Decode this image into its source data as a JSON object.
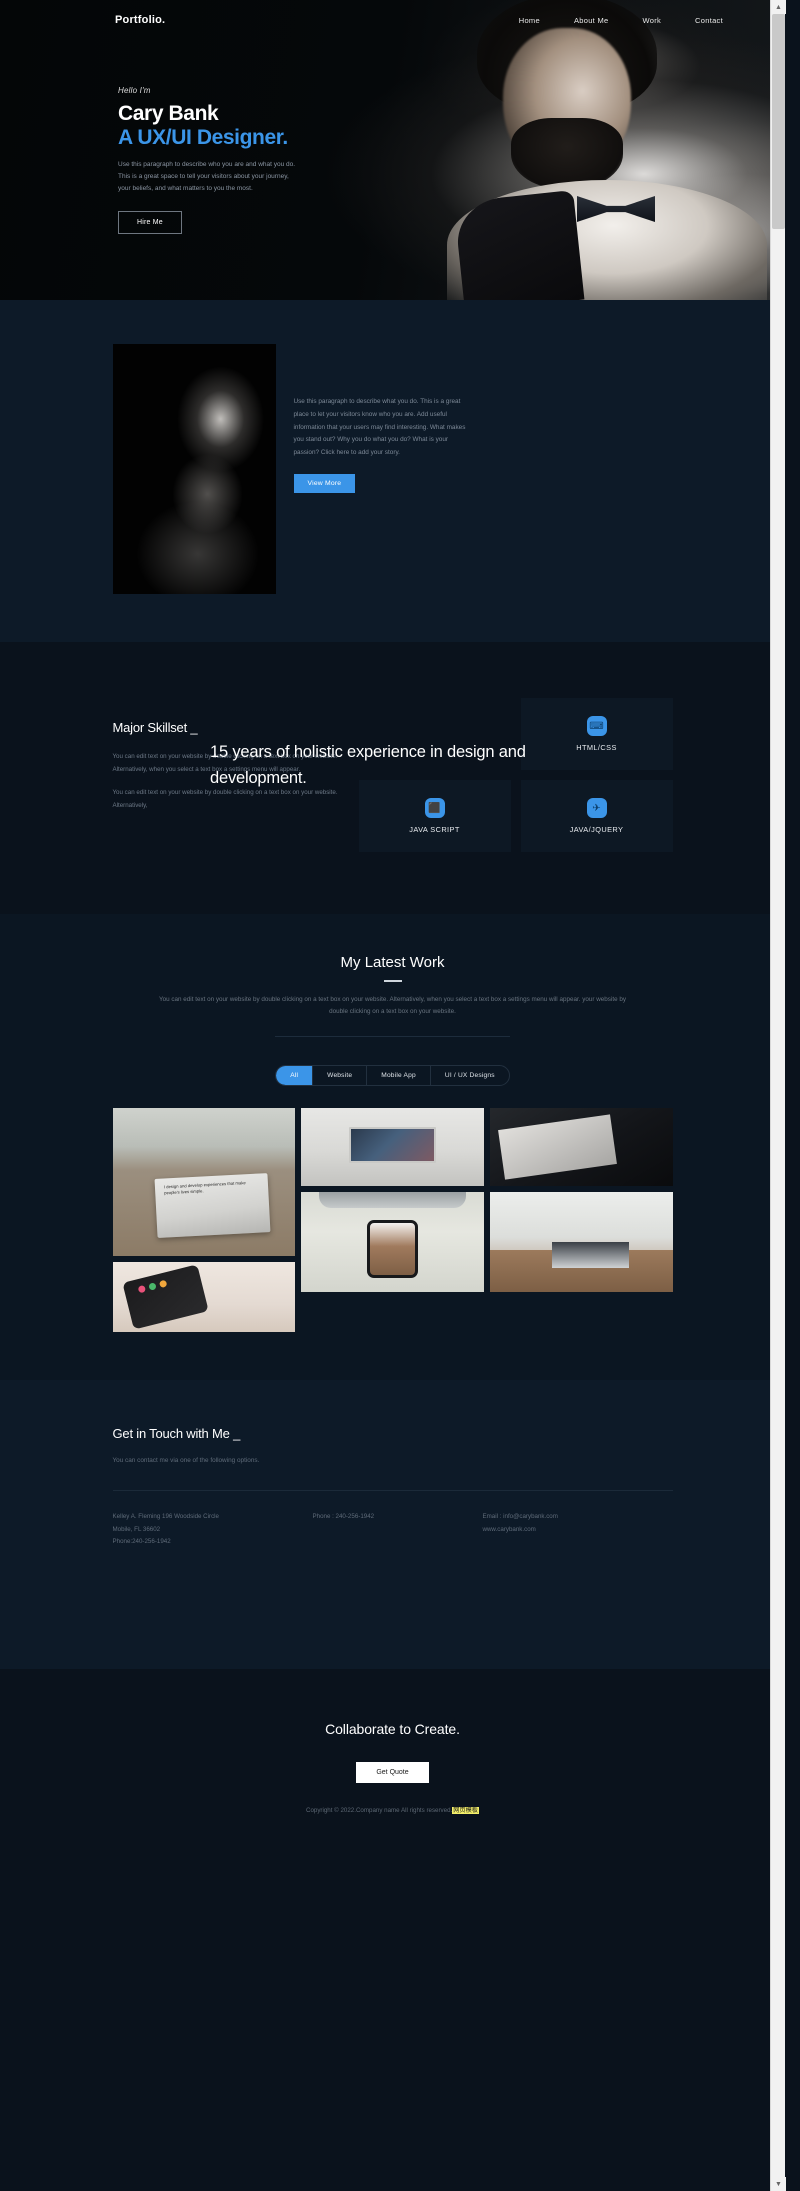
{
  "nav": {
    "logo": "Portfolio.",
    "links": [
      {
        "label": "Home"
      },
      {
        "label": "About Me"
      },
      {
        "label": "Work"
      },
      {
        "label": "Contact"
      }
    ]
  },
  "hero": {
    "greeting": "Hello I'm",
    "name": "Cary Bank",
    "role": "A UX/UI Designer.",
    "description": "Use this paragraph to describe who you are and what you do. This is a great space to tell your visitors about your journey, your beliefs, and what matters to you the most.",
    "cta": "Hire Me",
    "accent_color": "#3b95e8"
  },
  "about": {
    "paragraph": "Use this paragraph to describe what you do. This is a great place to let your visitors know who you are. Add useful information that your users may find interesting. What makes you stand out? Why you do what you do? What is your passion? Click here to add your story.",
    "cta": "View More",
    "headline": "15 years of holistic experience in design and development."
  },
  "skills": {
    "title": "Major Skillset _",
    "paragraphs": [
      "You can edit text on your website by double clicking on a text box on your website. Alternatively, when you select a text box a settings menu will appear.",
      "You can edit text on your website by double clicking on a text box on your website. Alternatively,"
    ],
    "cards": [
      {
        "label": "HTML/CSS",
        "icon": "code-icon",
        "glyph": "⌨"
      },
      {
        "label": "JAVA SCRIPT",
        "icon": "monitor-icon",
        "glyph": "⬛"
      },
      {
        "label": "JAVA/JQUERY",
        "icon": "rocket-icon",
        "glyph": "✈"
      }
    ]
  },
  "work": {
    "title": "My Latest Work",
    "description": "You can edit text on your website by double clicking on a text box on your website. Alternatively, when you select a text box a settings menu will appear. your website by double clicking on a text box on your website.",
    "filters": [
      {
        "label": "All",
        "active": true
      },
      {
        "label": "Website",
        "active": false
      },
      {
        "label": "Mobile App",
        "active": false
      },
      {
        "label": "UI / UX Designs",
        "active": false
      }
    ],
    "items": [
      {
        "name": "laptop-on-patio-table",
        "caption": "I design and develop experiences that make people's lives simple."
      },
      {
        "name": "phone-on-notebook"
      },
      {
        "name": "laptop-with-colorful-website"
      },
      {
        "name": "phone-mockup-on-wall"
      },
      {
        "name": "sketch-papers-on-dark-desk"
      },
      {
        "name": "office-workspace-with-laptop"
      }
    ]
  },
  "contact": {
    "title": "Get in Touch with Me _",
    "subtitle": "You can contact me via one of the following options.",
    "address_lines": [
      "Kelley A. Fleming 196 Woodside Circle",
      "Mobile, FL 36602",
      "Phone:240-256-1942"
    ],
    "phone_line": "Phone : 240-256-1942",
    "email_lines": [
      "Email : info@carybank.com",
      "www.carybank.com"
    ]
  },
  "footer": {
    "title": "Collaborate to Create.",
    "cta": "Get Quote",
    "copyright_prefix": "Copyright © 2022.Company name All rights reserved.",
    "copyright_highlight": "网页模板"
  }
}
